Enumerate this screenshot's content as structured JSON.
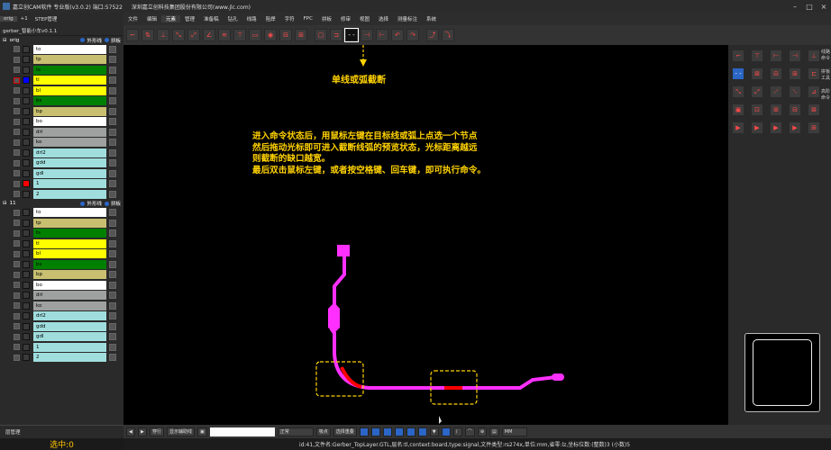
{
  "title": {
    "app": "嘉立创CAM软件 专业版(v3.0.2) 端口:57522",
    "company": "深圳嘉立创科技集团股份有限公司(www.jlc.com)"
  },
  "menu": [
    "文件",
    "编辑",
    "元素",
    "管理",
    "准备稿",
    "钻孔",
    "线路",
    "阻焊",
    "字符",
    "FPC",
    "拼板",
    "修审",
    "视图",
    "选择",
    "测量标注",
    "系统"
  ],
  "left": {
    "tabs": [
      "orig",
      "+1",
      "STEP管理"
    ],
    "group_name": "gerber_智能小车v0.1.1",
    "sections": [
      {
        "name": "orig",
        "outline": "外形线",
        "panel": "拼板",
        "layers": [
          {
            "name": "to",
            "color": "#ffffff"
          },
          {
            "name": "tp",
            "color": "#c8c070"
          },
          {
            "name": "ts",
            "color": "#008000"
          },
          {
            "name": "tl",
            "color": "#ffff00",
            "swatch": "#0000ff",
            "red": true
          },
          {
            "name": "bl",
            "color": "#ffff00"
          },
          {
            "name": "bs",
            "color": "#008000"
          },
          {
            "name": "bp",
            "color": "#c8c070"
          },
          {
            "name": "bo",
            "color": "#ffffff"
          },
          {
            "name": "drl",
            "color": "#9fa0a0"
          },
          {
            "name": "ko",
            "color": "#9fa0a0"
          },
          {
            "name": "drl2",
            "color": "#a0dede"
          },
          {
            "name": "gdd",
            "color": "#a0dede"
          },
          {
            "name": "gdl",
            "color": "#a0dede"
          },
          {
            "name": "1",
            "color": "#a0dede",
            "swatch": "#ff0000"
          },
          {
            "name": "2",
            "color": "#a0dede"
          }
        ]
      },
      {
        "name": "11",
        "outline": "外形线",
        "panel": "拼板",
        "layers": [
          {
            "name": "to",
            "color": "#ffffff"
          },
          {
            "name": "tp",
            "color": "#c8c070"
          },
          {
            "name": "ts",
            "color": "#008000"
          },
          {
            "name": "tl",
            "color": "#ffff00"
          },
          {
            "name": "bl",
            "color": "#ffff00"
          },
          {
            "name": "bs",
            "color": "#008000"
          },
          {
            "name": "bp",
            "color": "#c8c070"
          },
          {
            "name": "bo",
            "color": "#ffffff"
          },
          {
            "name": "drl",
            "color": "#9fa0a0"
          },
          {
            "name": "ko",
            "color": "#9fa0a0"
          },
          {
            "name": "drl2",
            "color": "#a0dede"
          },
          {
            "name": "gdd",
            "color": "#a0dede"
          },
          {
            "name": "gdl",
            "color": "#a0dede"
          },
          {
            "name": "1",
            "color": "#a0dede"
          },
          {
            "name": "2",
            "color": "#a0dede"
          }
        ]
      }
    ],
    "layer_manager": "层管理",
    "selected_count": "选中:0"
  },
  "right_labels": [
    "线路命令",
    "拼板工具",
    "高阶命令"
  ],
  "canvas": {
    "feature_title": "单线或弧截断",
    "instructions": [
      "进入命令状态后，用鼠标左键在目标线或弧上点选一个节点",
      "然后拖动光标即可进入截断线弧的预览状态，光标距离越远",
      "则截断的缺口越宽。",
      "最后双击鼠标左键，或者按空格键、回车键，即可执行命令。"
    ]
  },
  "bottom": {
    "zoom_option": "穿行",
    "show_drawing": "显示辅助线",
    "mode": "正常",
    "snap": "吸点",
    "select_mode": "选择重叠",
    "unit": "MM"
  },
  "status": "id:41,文件名:Gerber_TopLayer.GTL,层名:tl,context:board,type:signal,文件类型:rs274x,单位:mm,省零:lz,坐标位数:(整数)3 (小数)5",
  "colors": {
    "trace": "#ff30ff",
    "cut": "#ff0000",
    "annotation": "#ffd200"
  }
}
